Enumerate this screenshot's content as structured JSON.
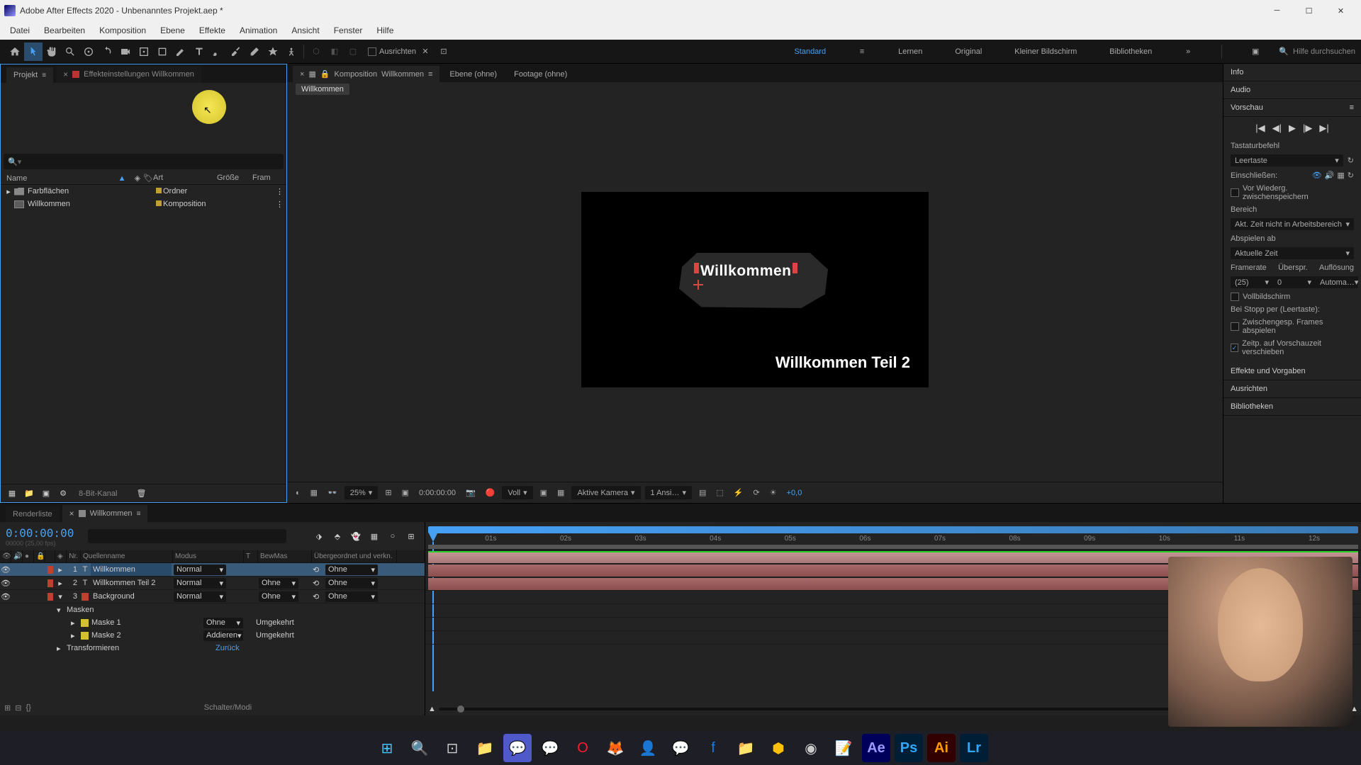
{
  "app_title": "Adobe After Effects 2020 - Unbenanntes Projekt.aep *",
  "menus": [
    "Datei",
    "Bearbeiten",
    "Komposition",
    "Ebene",
    "Effekte",
    "Animation",
    "Ansicht",
    "Fenster",
    "Hilfe"
  ],
  "toolbar": {
    "align_label": "Ausrichten",
    "search_placeholder": "Hilfe durchsuchen",
    "workspaces": [
      "Standard",
      "Lernen",
      "Original",
      "Kleiner Bildschirm",
      "Bibliotheken"
    ]
  },
  "project": {
    "tab_project": "Projekt",
    "tab_effect": "Effekteinstellungen Willkommen",
    "cols": {
      "name": "Name",
      "art": "Art",
      "size": "Größe",
      "frame": "Fram"
    },
    "rows": [
      {
        "name": "Farbflächen",
        "type": "Ordner",
        "color": "#c0a030",
        "kind": "folder"
      },
      {
        "name": "Willkommen",
        "type": "Komposition",
        "color": "#c0a030",
        "kind": "comp"
      }
    ],
    "bit_depth": "8-Bit-Kanal"
  },
  "comp": {
    "tab_label": "Komposition",
    "comp_name": "Willkommen",
    "tab_ebene": "Ebene (ohne)",
    "tab_footage": "Footage (ohne)",
    "flow_path": "Willkommen",
    "text1": "Willkommen",
    "text2": "Willkommen Teil 2",
    "zoom": "25%",
    "time": "0:00:00:00",
    "resolution": "Voll",
    "camera": "Aktive Kamera",
    "views": "1 Ansi…",
    "exposure": "+0,0"
  },
  "right": {
    "info": "Info",
    "audio": "Audio",
    "preview": "Vorschau",
    "shortcut_label": "Tastaturbefehl",
    "shortcut_value": "Leertaste",
    "include": "Einschließen:",
    "cache_before": "Vor Wiederg. zwischenspeichern",
    "range": "Bereich",
    "range_value": "Akt. Zeit nicht in Arbeitsbereich",
    "play_from": "Abspielen ab",
    "play_from_value": "Aktuelle Zeit",
    "framerate": "Framerate",
    "skip": "Überspr.",
    "res": "Auflösung",
    "fr_val": "(25)",
    "skip_val": "0",
    "res_val": "Automa…",
    "fullscreen": "Vollbildschirm",
    "on_stop": "Bei Stopp per (Leertaste):",
    "cached_frames": "Zwischengesp. Frames abspielen",
    "move_time": "Zeitp. auf Vorschauzeit verschieben",
    "effects": "Effekte und Vorgaben",
    "align": "Ausrichten",
    "libs": "Bibliotheken"
  },
  "timeline": {
    "tab_render": "Renderliste",
    "tab_comp": "Willkommen",
    "timecode": "0:00:00:00",
    "timecode_sub": "00000 (25,00 fps)",
    "cols": {
      "nr": "Nr.",
      "name": "Quellenname",
      "modus": "Modus",
      "t": "T",
      "bew": "BewMas",
      "parent": "Übergeordnet und verkn."
    },
    "layers": [
      {
        "nr": "1",
        "name": "Willkommen",
        "modus": "Normal",
        "bew": "",
        "parent": "Ohne",
        "color": "#c04030",
        "type": "T",
        "selected": true
      },
      {
        "nr": "2",
        "name": "Willkommen Teil 2",
        "modus": "Normal",
        "bew": "Ohne",
        "parent": "Ohne",
        "color": "#c04030",
        "type": "T",
        "selected": false
      },
      {
        "nr": "3",
        "name": "Background",
        "modus": "Normal",
        "bew": "Ohne",
        "parent": "Ohne",
        "color": "#c04030",
        "type": "solid",
        "selected": false,
        "expanded": true
      }
    ],
    "masks_label": "Masken",
    "masks": [
      {
        "name": "Maske 1",
        "color": "#d4c030",
        "mode": "Ohne",
        "inverted": "Umgekehrt"
      },
      {
        "name": "Maske 2",
        "color": "#d4c030",
        "mode": "Addieren",
        "inverted": "Umgekehrt"
      }
    ],
    "transform": "Transformieren",
    "transform_reset": "Zurück",
    "switches": "Schalter/Modi",
    "ticks": [
      "01s",
      "02s",
      "03s",
      "04s",
      "05s",
      "06s",
      "07s",
      "08s",
      "09s",
      "10s",
      "11s",
      "12s"
    ]
  }
}
